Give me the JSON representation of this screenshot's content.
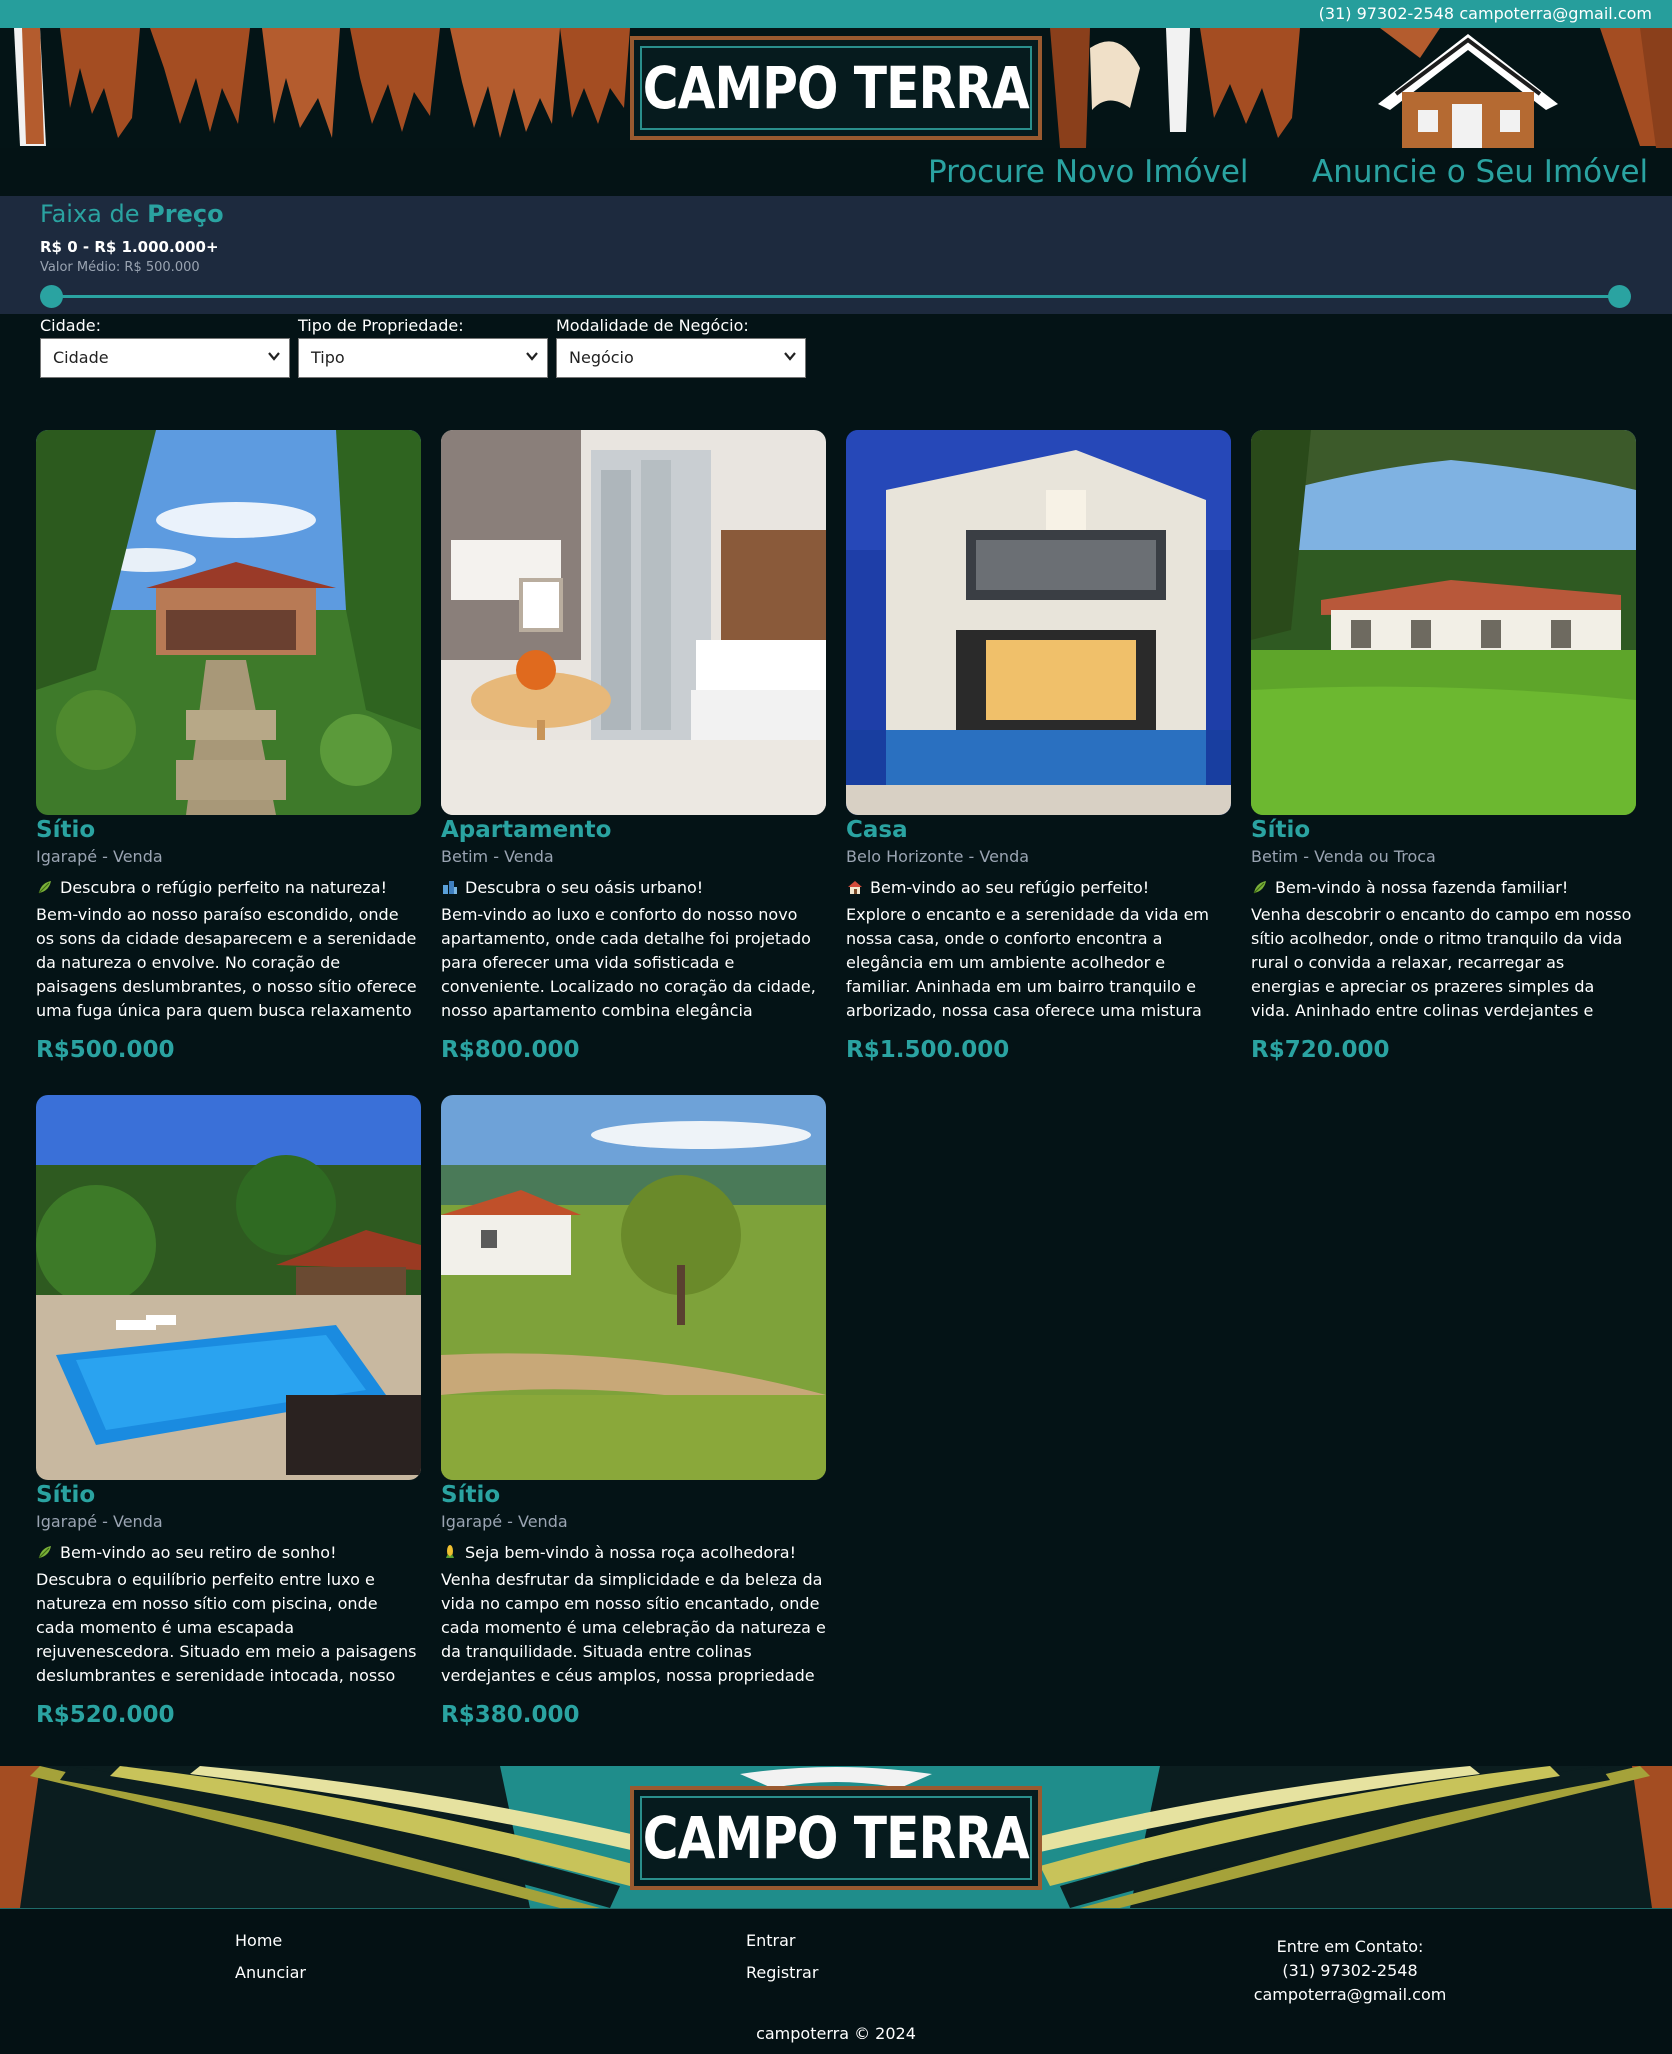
{
  "topbar": {
    "phone": "(31) 97302-2548",
    "email": "campoterra@gmail.com"
  },
  "brand": {
    "logo_text": "CAMPO TERRA"
  },
  "nav": {
    "procure": "Procure Novo Imóvel",
    "anuncie": "Anuncie o Seu Imóvel"
  },
  "price_filter": {
    "title_prefix": "Faixa de",
    "title_bold": "Preço",
    "range": "R$ 0 - R$ 1.000.000+",
    "average": "Valor Médio: R$ 500.000",
    "slider_min_fraction": 0,
    "slider_max_fraction": 1
  },
  "filters": {
    "city": {
      "label": "Cidade:",
      "value": "Cidade"
    },
    "type": {
      "label": "Tipo de Propriedade:",
      "value": "Tipo"
    },
    "business": {
      "label": "Modalidade de Negócio:",
      "value": "Negócio"
    }
  },
  "listings": [
    {
      "title": "Sítio",
      "location": "Igarapé - Venda",
      "emoji": "leaf-icon",
      "tagline": "Descubra o refúgio perfeito na natureza!",
      "description": "Bem-vindo ao nosso paraíso escondido, onde os sons da cidade desaparecem e a serenidade da natureza o envolve. No coração de paisagens deslumbrantes, o nosso sítio oferece uma fuga única para quem busca relaxamento e aventura.",
      "price": "R$500.000"
    },
    {
      "title": "Apartamento",
      "location": "Betim - Venda",
      "emoji": "city-icon",
      "tagline": "Descubra o seu oásis urbano!",
      "description": "Bem-vindo ao luxo e conforto do nosso novo apartamento, onde cada detalhe foi projetado para oferecer uma vida sofisticada e conveniente. Localizado no coração da cidade, nosso apartamento combina elegância contemporânea...",
      "price": "R$800.000"
    },
    {
      "title": "Casa",
      "location": "Belo Horizonte - Venda",
      "emoji": "house-icon",
      "tagline": "Bem-vindo ao seu refúgio perfeito!",
      "description": "Explore o encanto e a serenidade da vida em nossa casa, onde o conforto encontra a elegância em um ambiente acolhedor e familiar. Aninhada em um bairro tranquilo e arborizado, nossa casa oferece uma mistura única de estilo clássico e...",
      "price": "R$1.500.000"
    },
    {
      "title": "Sítio",
      "location": "Betim - Venda ou Troca",
      "emoji": "leaf-icon",
      "tagline": "Bem-vindo à nossa fazenda familiar!",
      "description": "Venha descobrir o encanto do campo em nosso sítio acolhedor, onde o ritmo tranquilo da vida rural o convida a relaxar, recarregar as energias e apreciar os prazeres simples da vida. Aninhado entre colinas verdejantes e cercado por vastos...",
      "price": "R$720.000"
    },
    {
      "title": "Sítio",
      "location": "Igarapé - Venda",
      "emoji": "leaf-icon",
      "tagline": "Bem-vindo ao seu retiro de sonho!",
      "description": "Descubra o equilíbrio perfeito entre luxo e natureza em nosso sítio com piscina, onde cada momento é uma escapada rejuvenescedora. Situado em meio a paisagens deslumbrantes e serenidade intocada, nosso sítio oferece uma...",
      "price": "R$520.000"
    },
    {
      "title": "Sítio",
      "location": "Igarapé - Venda",
      "emoji": "corn-icon",
      "tagline": "Seja bem-vindo à nossa roça acolhedora!",
      "description": "Venha desfrutar da simplicidade e da beleza da vida no campo em nosso sítio encantado, onde cada momento é uma celebração da natureza e da tranquilidade. Situada entre colinas verdejantes e céus amplos, nossa propriedade oferece um...",
      "price": "R$380.000"
    }
  ],
  "footer": {
    "home": "Home",
    "anunciar": "Anunciar",
    "entrar": "Entrar",
    "registrar": "Registrar",
    "contact_title": "Entre em Contato:",
    "contact_phone": "(31) 97302-2548",
    "contact_email": "campoterra@gmail.com",
    "copyright": "campoterra © 2024"
  },
  "colors": {
    "accent": "#2aa3a1",
    "background": "#041316",
    "price_panel": "#1d2a3e"
  }
}
